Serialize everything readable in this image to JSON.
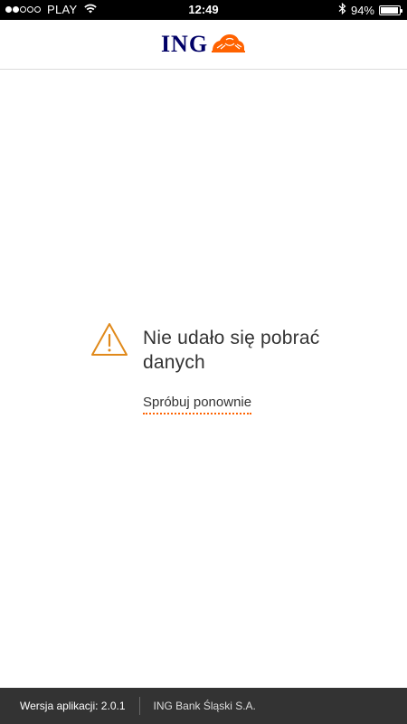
{
  "status_bar": {
    "carrier": "PLAY",
    "time": "12:49",
    "battery_percent": "94%",
    "battery_level": 0.94,
    "signal_strength": 2,
    "signal_max": 5,
    "icons": [
      "wifi-icon",
      "bluetooth-icon",
      "battery-icon"
    ]
  },
  "header": {
    "logo_text": "ING",
    "logo_icon": "lion-logo-icon",
    "brand_color": "#000066",
    "accent_color": "#ff6200"
  },
  "error": {
    "icon": "warning-icon",
    "message": "Nie udało się pobrać danych",
    "retry_label": "Spróbuj ponownie"
  },
  "footer": {
    "version": "Wersja aplikacji: 2.0.1",
    "company": "ING Bank Śląski S.A."
  }
}
